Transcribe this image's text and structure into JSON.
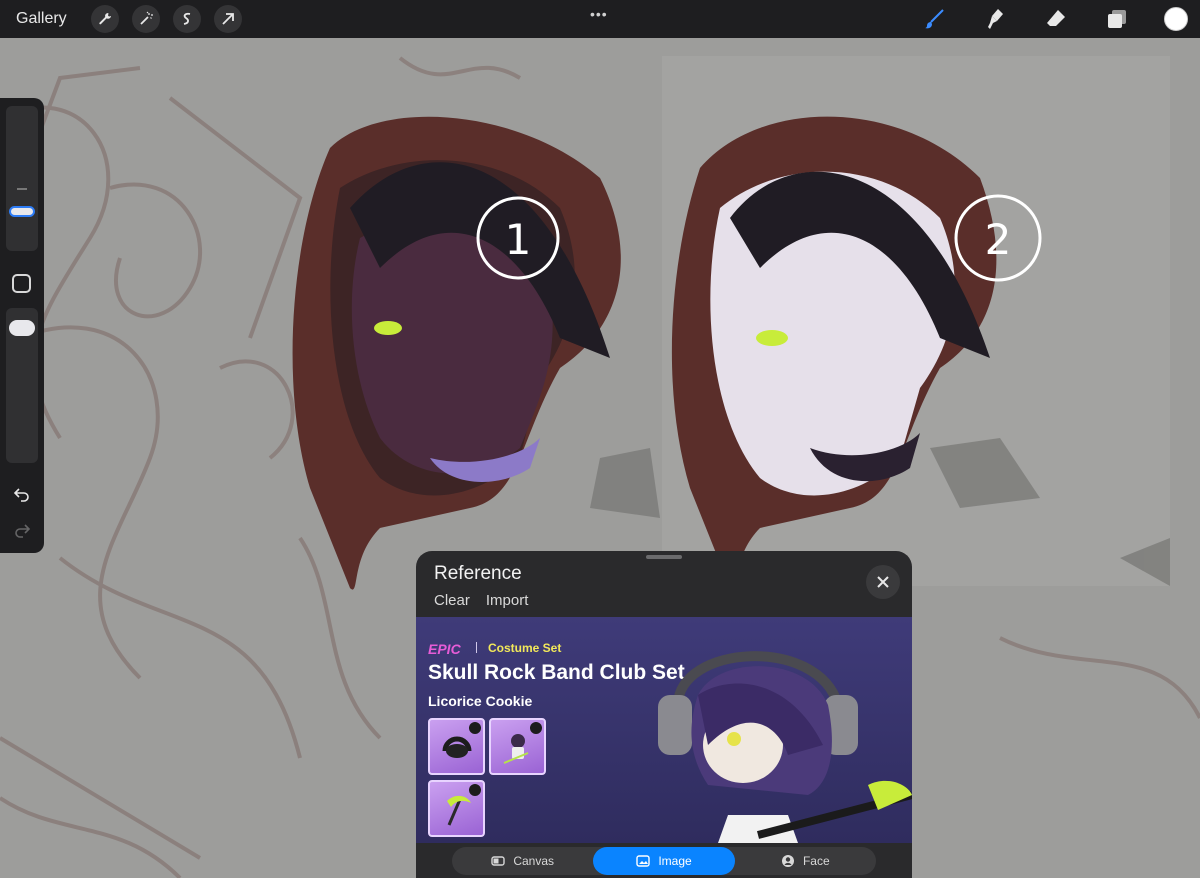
{
  "topbar": {
    "gallery_label": "Gallery",
    "left_tools": [
      "wrench-icon",
      "magic-wand-icon",
      "selection-icon",
      "transform-arrow-icon"
    ],
    "right_tools": [
      "brush-icon",
      "smudge-icon",
      "eraser-icon",
      "layers-icon"
    ],
    "current_color": "#ffffff",
    "accent_color": "#0a84ff"
  },
  "canvas": {
    "annotation_1": "1",
    "annotation_2": "2"
  },
  "reference": {
    "title": "Reference",
    "clear_label": "Clear",
    "import_label": "Import",
    "card": {
      "rarity": "EPIC",
      "set_type": "Costume Set",
      "set_name": "Skull Rock Band Club Set",
      "cookie_name": "Licorice Cookie"
    },
    "tabs": [
      {
        "label": "Canvas",
        "icon": "canvas-icon",
        "active": false
      },
      {
        "label": "Image",
        "icon": "image-icon",
        "active": true
      },
      {
        "label": "Face",
        "icon": "face-icon",
        "active": false
      }
    ]
  }
}
